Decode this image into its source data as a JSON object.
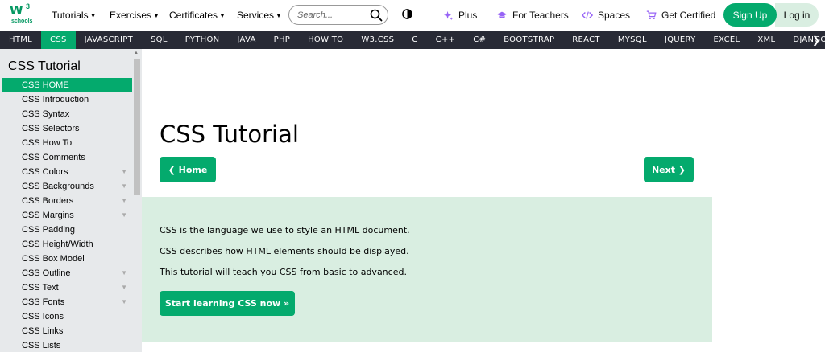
{
  "logo": {
    "text": "W",
    "superscript": "3",
    "subtext": "schools"
  },
  "topnav": {
    "tutorials": "Tutorials",
    "exercises": "Exercises",
    "certificates": "Certificates",
    "services": "Services",
    "search_placeholder": "Search...",
    "plus": "Plus",
    "for_teachers": "For Teachers",
    "spaces": "Spaces",
    "get_certified": "Get Certified",
    "sign_up": "Sign Up",
    "log_in": "Log in"
  },
  "langbar": [
    "HTML",
    "CSS",
    "JAVASCRIPT",
    "SQL",
    "PYTHON",
    "JAVA",
    "PHP",
    "HOW TO",
    "W3.CSS",
    "C",
    "C++",
    "C#",
    "BOOTSTRAP",
    "REACT",
    "MYSQL",
    "JQUERY",
    "EXCEL",
    "XML",
    "DJANGO"
  ],
  "langbar_active": "CSS",
  "sidebar": {
    "title": "CSS Tutorial",
    "items": [
      {
        "label": "CSS HOME",
        "active": true,
        "expandable": false
      },
      {
        "label": "CSS Introduction",
        "expandable": false
      },
      {
        "label": "CSS Syntax",
        "expandable": false
      },
      {
        "label": "CSS Selectors",
        "expandable": false
      },
      {
        "label": "CSS How To",
        "expandable": false
      },
      {
        "label": "CSS Comments",
        "expandable": false
      },
      {
        "label": "CSS Colors",
        "expandable": true
      },
      {
        "label": "CSS Backgrounds",
        "expandable": true
      },
      {
        "label": "CSS Borders",
        "expandable": true
      },
      {
        "label": "CSS Margins",
        "expandable": true
      },
      {
        "label": "CSS Padding",
        "expandable": false
      },
      {
        "label": "CSS Height/Width",
        "expandable": false
      },
      {
        "label": "CSS Box Model",
        "expandable": false
      },
      {
        "label": "CSS Outline",
        "expandable": true
      },
      {
        "label": "CSS Text",
        "expandable": true
      },
      {
        "label": "CSS Fonts",
        "expandable": true
      },
      {
        "label": "CSS Icons",
        "expandable": false
      },
      {
        "label": "CSS Links",
        "expandable": false
      },
      {
        "label": "CSS Lists",
        "expandable": false
      }
    ]
  },
  "main": {
    "title": "CSS Tutorial",
    "home_button": "❮ Home",
    "next_button": "Next ❯",
    "intro_lines": [
      "CSS is the language we use to style an HTML document.",
      "CSS describes how HTML elements should be displayed.",
      "This tutorial will teach you CSS from basic to advanced."
    ],
    "start_button": "Start learning CSS now »"
  },
  "colors": {
    "brand_green": "#04aa6d",
    "langbar_bg": "#282a35",
    "sidebar_bg": "#e7e9eb",
    "intro_bg": "#d9eee1"
  }
}
